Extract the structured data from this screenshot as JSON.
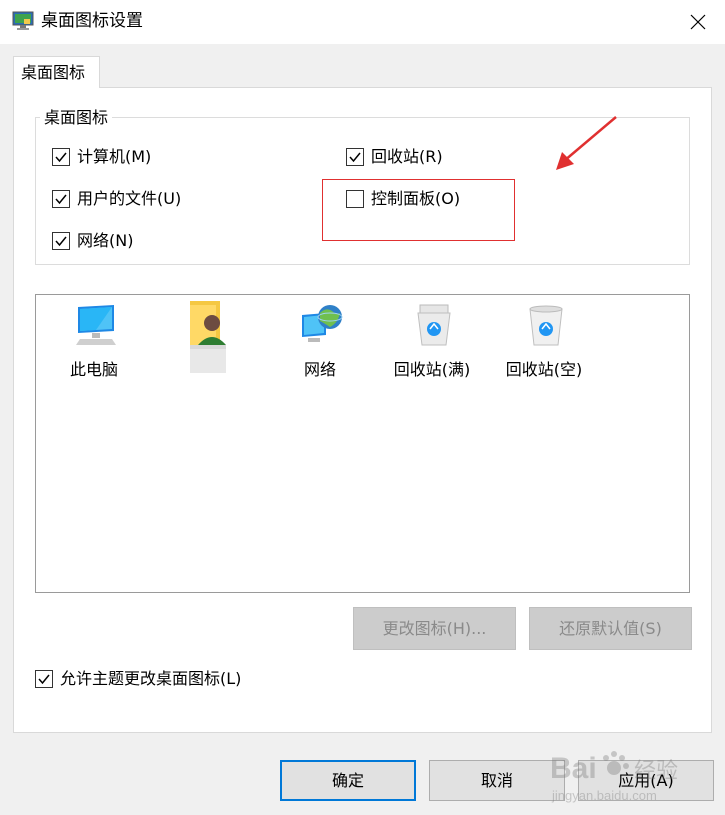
{
  "window": {
    "title": "桌面图标设置"
  },
  "tabs": [
    {
      "label": "桌面图标"
    }
  ],
  "group": {
    "legend": "桌面图标",
    "checkboxes": [
      {
        "label": "计算机(M)",
        "checked": true
      },
      {
        "label": "回收站(R)",
        "checked": true
      },
      {
        "label": "用户的文件(U)",
        "checked": true
      },
      {
        "label": "控制面板(O)",
        "checked": false
      },
      {
        "label": "网络(N)",
        "checked": true
      }
    ]
  },
  "icons": [
    {
      "label": "此电脑",
      "icon": "computer-icon"
    },
    {
      "label": "",
      "icon": "user-folder-icon"
    },
    {
      "label": "网络",
      "icon": "network-icon"
    },
    {
      "label": "回收站(满)",
      "icon": "recycle-bin-full-icon"
    },
    {
      "label": "回收站(空)",
      "icon": "recycle-bin-empty-icon"
    }
  ],
  "buttons": {
    "change_icon": "更改图标(H)...",
    "restore_default": "还原默认值(S)",
    "ok": "确定",
    "cancel": "取消",
    "apply": "应用(A)"
  },
  "allow_themes": {
    "label": "允许主题更改桌面图标(L)",
    "checked": true
  },
  "watermark": {
    "brand": "Bai",
    "sub": "经验",
    "url": "jingyan.baidu.com"
  },
  "colors": {
    "highlight": "#e03030",
    "accent": "#0078d7",
    "disabled_bg": "#cccccc",
    "disabled_text": "#8a8a8a"
  }
}
